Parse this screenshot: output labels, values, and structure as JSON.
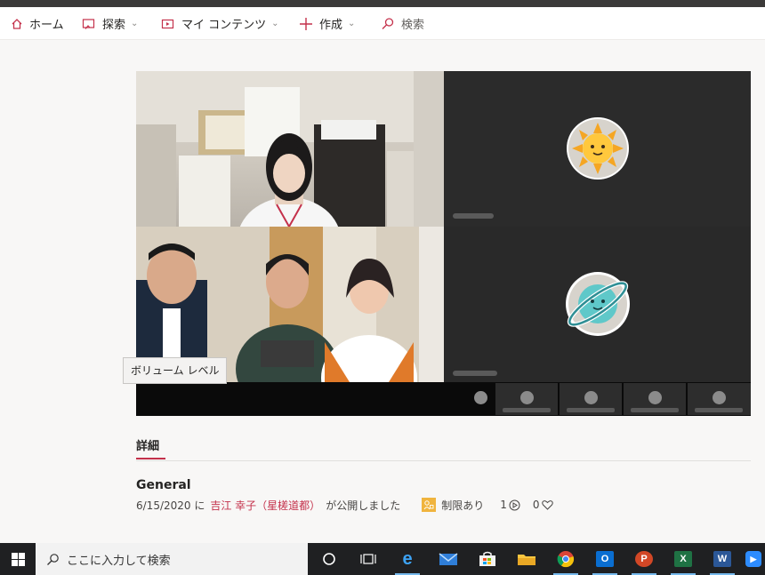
{
  "nav": {
    "home": "ホーム",
    "explore": "探索",
    "my_content": "マイ コンテンツ",
    "create": "作成",
    "search": "検索"
  },
  "player": {
    "tooltip": "ボリューム レベル",
    "participant_icons": [
      "sun-emoji-avatar",
      "planet-emoji-avatar"
    ]
  },
  "details": {
    "tab": "詳細",
    "title": "General",
    "date_prefix": "6/15/2020 に",
    "author": "吉江 幸子（星槎道都）",
    "published_suffix": "が公開しました",
    "permission": "制限あり",
    "views": "1",
    "likes": "0"
  },
  "taskbar": {
    "search_placeholder": "ここに入力して検索",
    "apps": [
      "cortana",
      "task-view",
      "edge",
      "mail",
      "store",
      "file-explorer",
      "chrome",
      "outlook",
      "powerpoint",
      "excel",
      "word",
      "zoom"
    ]
  },
  "colors": {
    "accent": "#c4314b",
    "permission_badge": "#f0b43e",
    "taskbar": "#1f2022"
  }
}
